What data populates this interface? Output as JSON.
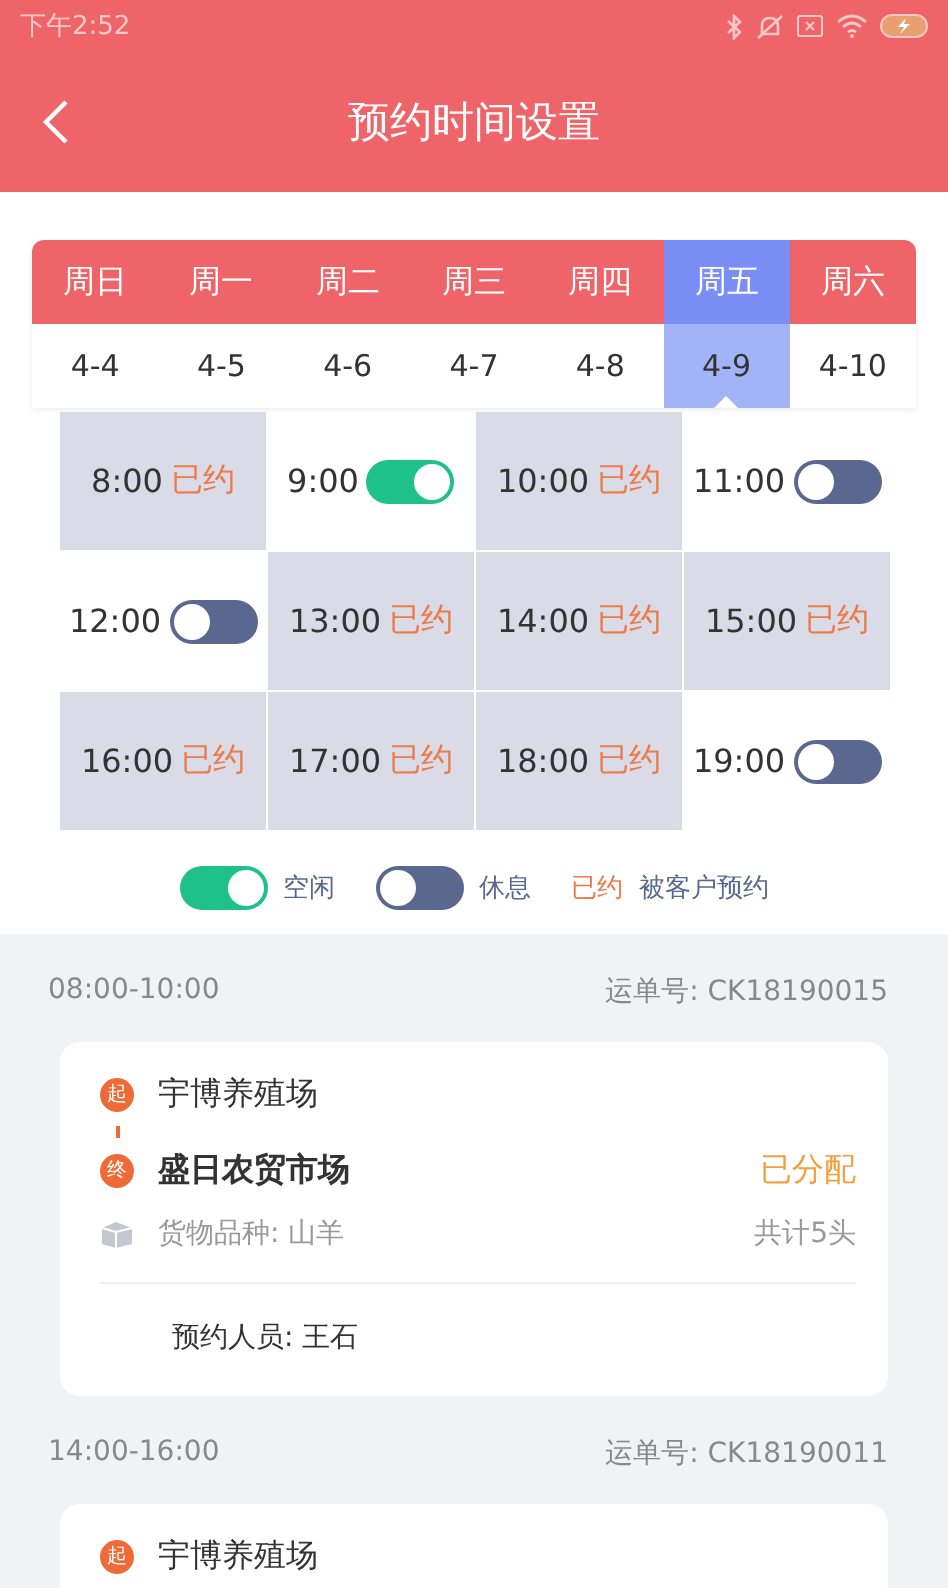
{
  "status_bar": {
    "time": "下午2:52"
  },
  "header": {
    "title": "预约时间设置"
  },
  "days": [
    {
      "weekday": "周日",
      "date": "4-4",
      "selected": false
    },
    {
      "weekday": "周一",
      "date": "4-5",
      "selected": false
    },
    {
      "weekday": "周二",
      "date": "4-6",
      "selected": false
    },
    {
      "weekday": "周三",
      "date": "4-7",
      "selected": false
    },
    {
      "weekday": "周四",
      "date": "4-8",
      "selected": false
    },
    {
      "weekday": "周五",
      "date": "4-9",
      "selected": true
    },
    {
      "weekday": "周六",
      "date": "4-10",
      "selected": false
    }
  ],
  "slots": [
    {
      "time": "8:00",
      "kind": "booked",
      "status": "已约"
    },
    {
      "time": "9:00",
      "kind": "toggle",
      "on": true
    },
    {
      "time": "10:00",
      "kind": "booked",
      "status": "已约"
    },
    {
      "time": "11:00",
      "kind": "toggle",
      "on": false
    },
    {
      "time": "12:00",
      "kind": "toggle",
      "on": false
    },
    {
      "time": "13:00",
      "kind": "booked",
      "status": "已约"
    },
    {
      "time": "14:00",
      "kind": "booked",
      "status": "已约"
    },
    {
      "time": "15:00",
      "kind": "booked",
      "status": "已约"
    },
    {
      "time": "16:00",
      "kind": "booked",
      "status": "已约"
    },
    {
      "time": "17:00",
      "kind": "booked",
      "status": "已约"
    },
    {
      "time": "18:00",
      "kind": "booked",
      "status": "已约"
    },
    {
      "time": "19:00",
      "kind": "toggle",
      "on": false
    }
  ],
  "legend": [
    {
      "kind": "toggle",
      "on": true,
      "label": "空闲"
    },
    {
      "kind": "toggle",
      "on": false,
      "label": "休息"
    },
    {
      "kind": "tag",
      "tag": "已约",
      "label": "被客户预约"
    }
  ],
  "orders": [
    {
      "time_range": "08:00-10:00",
      "order_no": "运单号: CK18190015",
      "start_badge": "起",
      "start": "宇博养殖场",
      "end_badge": "终",
      "end": "盛日农贸市场",
      "status": "已分配",
      "cargo": "货物品种: 山羊",
      "count": "共计5头",
      "booker": "预约人员: 王石"
    },
    {
      "time_range": "14:00-16:00",
      "order_no": "运单号: CK18190011",
      "start_badge": "起",
      "start": "宇博养殖场"
    }
  ]
}
